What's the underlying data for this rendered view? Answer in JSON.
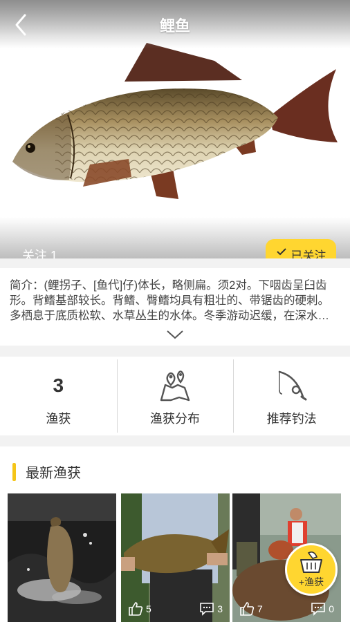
{
  "header": {
    "title": "鲤鱼",
    "back_icon": "chevron-left-icon"
  },
  "hero": {
    "image": "common-carp",
    "follow_count": "关注 1",
    "follow_button": "已关注",
    "follow_icon": "check-icon"
  },
  "intro": {
    "text": "简介：(鲤拐子、[鱼代]仔)体长，略侧扁。须2对。下咽齿呈臼齿形。背鳍基部较长。背鳍、臀鳍均具有粗壮的、带锯齿的硬刺。多栖息于底质松软、水草丛生的水体。冬季游动迟缓，在深水…",
    "expand_icon": "chevron-down-icon"
  },
  "stats": [
    {
      "value": "3",
      "label": "渔获"
    },
    {
      "icon": "map-pin-icon",
      "label": "渔获分布"
    },
    {
      "icon": "fishing-rod-icon",
      "label": "推荐钓法"
    }
  ],
  "latest": {
    "title": "最新渔获",
    "cards": [
      {
        "likes": "",
        "comments": ""
      },
      {
        "likes": "5",
        "comments": "3"
      },
      {
        "likes": "7",
        "comments": "0"
      }
    ]
  },
  "fab": {
    "label": "+渔获",
    "icon": "basket-icon"
  },
  "colors": {
    "accent": "#ffd630",
    "section_bar": "#f5c518"
  }
}
